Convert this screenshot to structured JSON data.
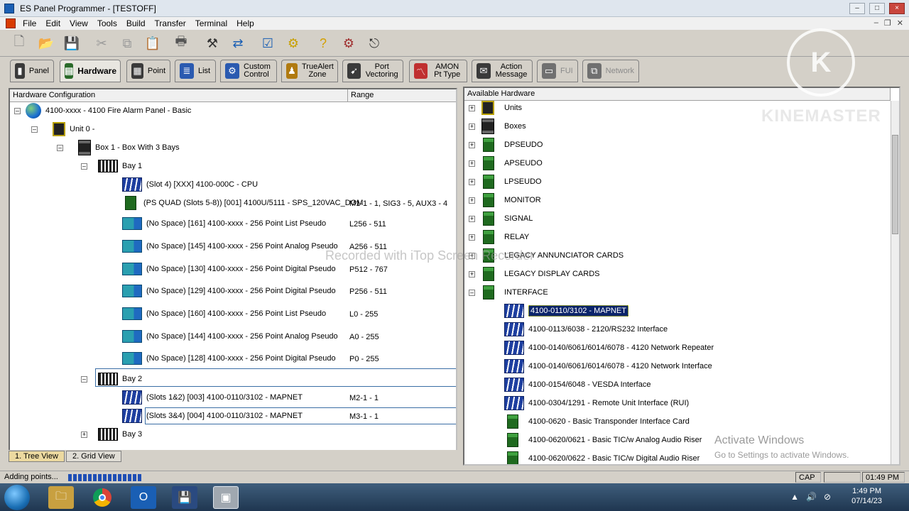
{
  "window": {
    "title": "ES Panel Programmer - [TESTOFF]"
  },
  "menu": [
    "File",
    "Edit",
    "View",
    "Tools",
    "Build",
    "Transfer",
    "Terminal",
    "Help"
  ],
  "tabs": [
    {
      "label": "Panel",
      "color": "#3a3a3a"
    },
    {
      "label": "Hardware",
      "color": "#2a6a2a"
    },
    {
      "label": "Point",
      "color": "#3a3a3a"
    },
    {
      "label": "List",
      "color": "#2a5ab0"
    },
    {
      "label": "Custom Control",
      "color": "#2a5ab0"
    },
    {
      "label": "TrueAlert Zone",
      "color": "#b07a10"
    },
    {
      "label": "Port Vectoring",
      "color": "#3a3a3a"
    },
    {
      "label": "AMON Pt Type",
      "color": "#c03030"
    },
    {
      "label": "Action Message",
      "color": "#3a3a3a"
    },
    {
      "label": "FUI",
      "color": "#707070"
    },
    {
      "label": "Network",
      "color": "#707070"
    }
  ],
  "left_panel": {
    "col_config": "Hardware Configuration",
    "col_range": "Range",
    "rows": [
      {
        "label": "4100-xxxx - 4100 Fire Alarm Panel - Basic",
        "range": ""
      },
      {
        "label": "Unit 0 -",
        "range": ""
      },
      {
        "label": "Box 1 - Box With 3 Bays",
        "range": ""
      },
      {
        "label": "Bay 1",
        "range": ""
      },
      {
        "label": "(Slot 4) [XXX] 4100-000C - CPU",
        "range": ""
      },
      {
        "label": "(PS QUAD (Slots 5-8)) [001] 4100U/5111 - SPS_120VAC_DOM",
        "range": "M1-1 - 1, SIG3 - 5, AUX3 - 4"
      },
      {
        "label": "(No Space) [161] 4100-xxxx - 256 Point List Pseudo",
        "range": "L256 - 511"
      },
      {
        "label": "(No Space) [145] 4100-xxxx - 256 Point Analog Pseudo",
        "range": "A256 - 511"
      },
      {
        "label": "(No Space) [130] 4100-xxxx - 256 Point Digital Pseudo",
        "range": "P512 - 767"
      },
      {
        "label": "(No Space) [129] 4100-xxxx - 256 Point Digital Pseudo",
        "range": "P256 - 511"
      },
      {
        "label": "(No Space) [160] 4100-xxxx - 256 Point List Pseudo",
        "range": "L0 - 255"
      },
      {
        "label": "(No Space) [144] 4100-xxxx - 256 Point Analog Pseudo",
        "range": "A0 - 255"
      },
      {
        "label": "(No Space) [128] 4100-xxxx - 256 Point Digital Pseudo",
        "range": "P0 - 255"
      },
      {
        "label": "Bay 2",
        "range": ""
      },
      {
        "label": "(Slots 1&2) [003] 4100-0110/3102 - MAPNET",
        "range": "M2-1 - 1"
      },
      {
        "label": "(Slots 3&4) [004] 4100-0110/3102 - MAPNET",
        "range": "M3-1 - 1"
      },
      {
        "label": "Bay 3",
        "range": ""
      }
    ],
    "bottom_tabs": [
      "1. Tree View",
      "2. Grid View"
    ]
  },
  "right_panel": {
    "header": "Available Hardware",
    "rows": [
      "Units",
      "Boxes",
      "DPSEUDO",
      "APSEUDO",
      "LPSEUDO",
      "MONITOR",
      "SIGNAL",
      "RELAY",
      "LEGACY ANNUNCIATOR CARDS",
      "LEGACY DISPLAY CARDS",
      "INTERFACE",
      "4100-0110/3102 - MAPNET",
      "4100-0113/6038 - 2120/RS232 Interface",
      "4100-0140/6061/6014/6078 - 4120 Network Repeater",
      "4100-0140/6061/6014/6078 - 4120 Network Interface",
      "4100-0154/6048 - VESDA Interface",
      "4100-0304/1291 - Remote Unit Interface (RUI)",
      "4100-0620 - Basic Transponder Interface Card",
      "4100-0620/0621 - Basic TIC/w Analog Audio Riser",
      "4100-0620/0622 - Basic TIC/w Digital Audio Riser"
    ]
  },
  "status": {
    "message": "Adding points...",
    "progress": 0.2,
    "cap": "CAP",
    "time": "01:49 PM"
  },
  "taskbar": {
    "clock_time": "1:49 PM",
    "clock_date": "07/14/23"
  },
  "overlays": {
    "watermark": "KINEMASTER",
    "logo_letter": "K",
    "recorded": "Recorded with iTop Screen Recorder",
    "activate_title": "Activate Windows",
    "activate_sub": "Go to Settings to activate Windows."
  }
}
